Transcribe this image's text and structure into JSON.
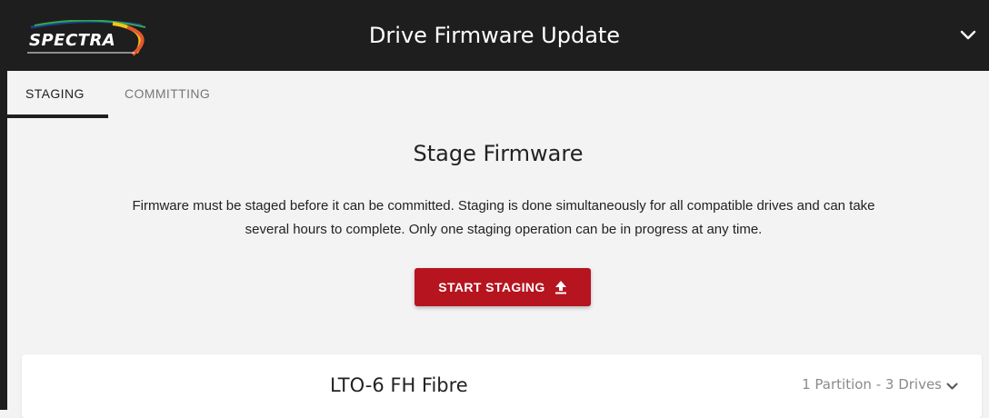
{
  "header": {
    "logo_text": "SPECTRA",
    "title": "Drive Firmware Update",
    "menu_icon": "chevron-down-icon"
  },
  "tabs": [
    {
      "label": "STAGING",
      "active": true
    },
    {
      "label": "COMMITTING",
      "active": false
    }
  ],
  "main": {
    "title": "Stage Firmware",
    "description_line1": "Firmware must be staged before it can be committed. Staging is done simultaneously for all compatible drives and can take",
    "description_line2": "several hours to complete. Only one staging operation can be in progress at any time.",
    "start_button": {
      "label": "START STAGING",
      "icon": "upload-icon"
    }
  },
  "drive_groups": [
    {
      "name": "LTO-6 FH Fibre",
      "summary": "1 Partition - 3 Drives",
      "expand_icon": "chevron-down-icon"
    }
  ],
  "colors": {
    "header_bg": "#1e1e1e",
    "accent_red": "#b6141f",
    "page_bg": "#f3f3f3",
    "logo_swoosh": [
      "#1f3f8f",
      "#2fa84f",
      "#f5c21a",
      "#e4572e"
    ]
  }
}
